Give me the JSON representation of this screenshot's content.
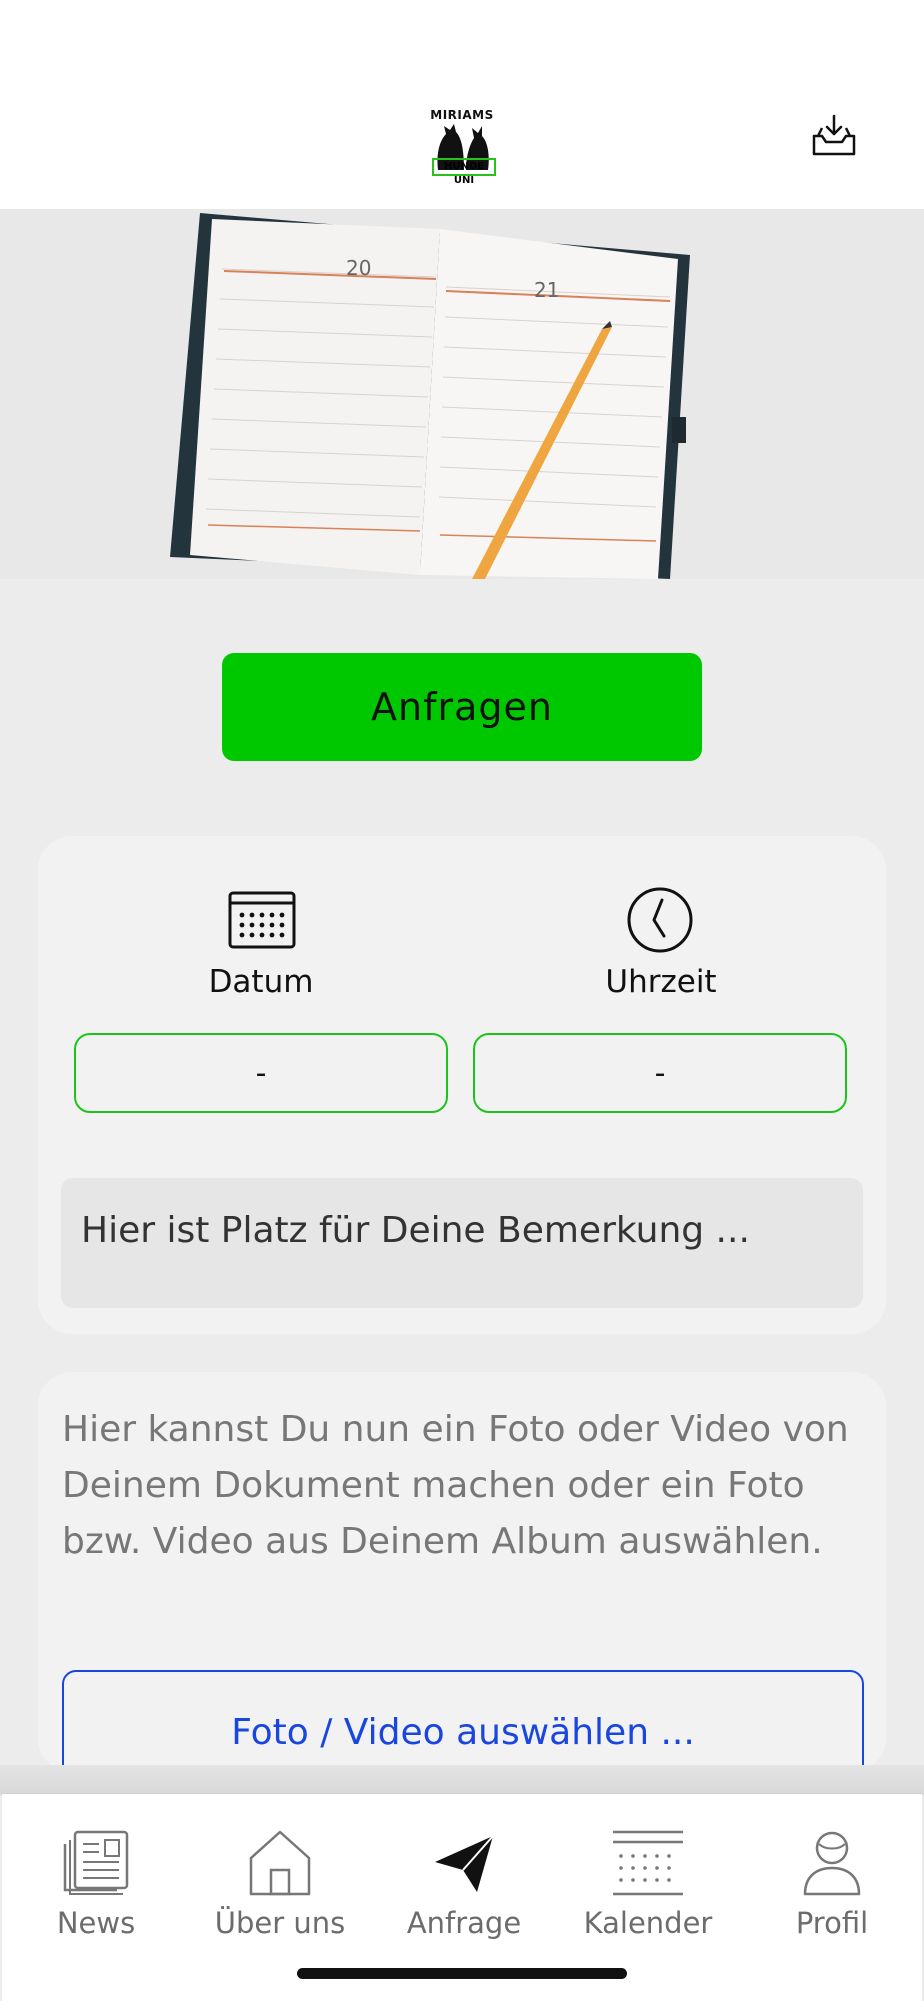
{
  "header": {
    "logo_top": "MIRIAMS",
    "logo_bottom": "HUNDE UNI",
    "inbox_icon": "inbox-download-icon"
  },
  "hero": {
    "page_left": "20",
    "page_right": "21"
  },
  "request_button": {
    "label": "Anfragen"
  },
  "datetime": {
    "date_label": "Datum",
    "time_label": "Uhrzeit",
    "date_value": "-",
    "time_value": "-",
    "date_icon": "calendar-icon",
    "time_icon": "clock-icon"
  },
  "remark": {
    "placeholder": "Hier ist Platz für Deine Bemerkung ..."
  },
  "media": {
    "description": "Hier kannst Du nun ein Foto oder Video von Deinem Dokument machen oder ein Foto bzw. Video aus Deinem Album auswählen.",
    "button_label": "Foto / Video auswählen ..."
  },
  "tabbar": {
    "items": [
      {
        "label": "News",
        "icon": "newspaper-icon",
        "active": false
      },
      {
        "label": "Über uns",
        "icon": "house-icon",
        "active": false
      },
      {
        "label": "Anfrage",
        "icon": "paper-plane-icon",
        "active": true
      },
      {
        "label": "Kalender",
        "icon": "calendar-icon",
        "active": false
      },
      {
        "label": "Profil",
        "icon": "user-icon",
        "active": false
      }
    ]
  },
  "colors": {
    "accent_green": "#00c800",
    "field_border": "#1cc41a",
    "link_blue": "#1a46e0"
  }
}
